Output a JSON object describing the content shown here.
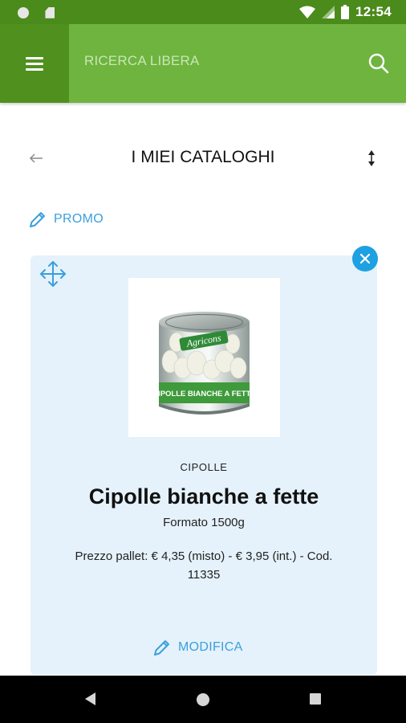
{
  "status_bar": {
    "time": "12:54",
    "icons": [
      "notification-dot-icon",
      "sim-card-icon",
      "wifi-icon",
      "signal-icon",
      "battery-icon"
    ]
  },
  "app_bar": {
    "menu_icon": "hamburger-menu-icon",
    "search_label": "RICERCA LIBERA",
    "search_icon": "search-icon",
    "background": "#6eb43f",
    "menu_background": "#4f901f"
  },
  "catalog": {
    "title": "I MIEI CATALOGHI",
    "back_icon": "arrow-left-icon",
    "sort_icon": "sort-vertical-icon"
  },
  "promo": {
    "label": "PROMO",
    "icon": "pencil-icon"
  },
  "product_card": {
    "background": "#e5f2fb",
    "move_icon": "move-icon",
    "close_icon": "close-icon",
    "image": {
      "brand": "Agricons",
      "can_label": "CIPOLLE BIANCHE A FETTE"
    },
    "category": "CIPOLLE",
    "name": "Cipolle bianche a fette",
    "format": "Formato 1500g",
    "price": "Prezzo pallet: € 4,35 (misto) - € 3,95 (int.) - Cod. 11335",
    "modify_label": "MODIFICA",
    "modify_icon": "pencil-icon"
  },
  "colors": {
    "accent_blue": "#3aa0dc",
    "close_blue": "#1ea0e2",
    "status_green": "#4a8b1b"
  },
  "nav_bar": {
    "icons": [
      "nav-back-icon",
      "nav-home-icon",
      "nav-recent-icon"
    ]
  }
}
